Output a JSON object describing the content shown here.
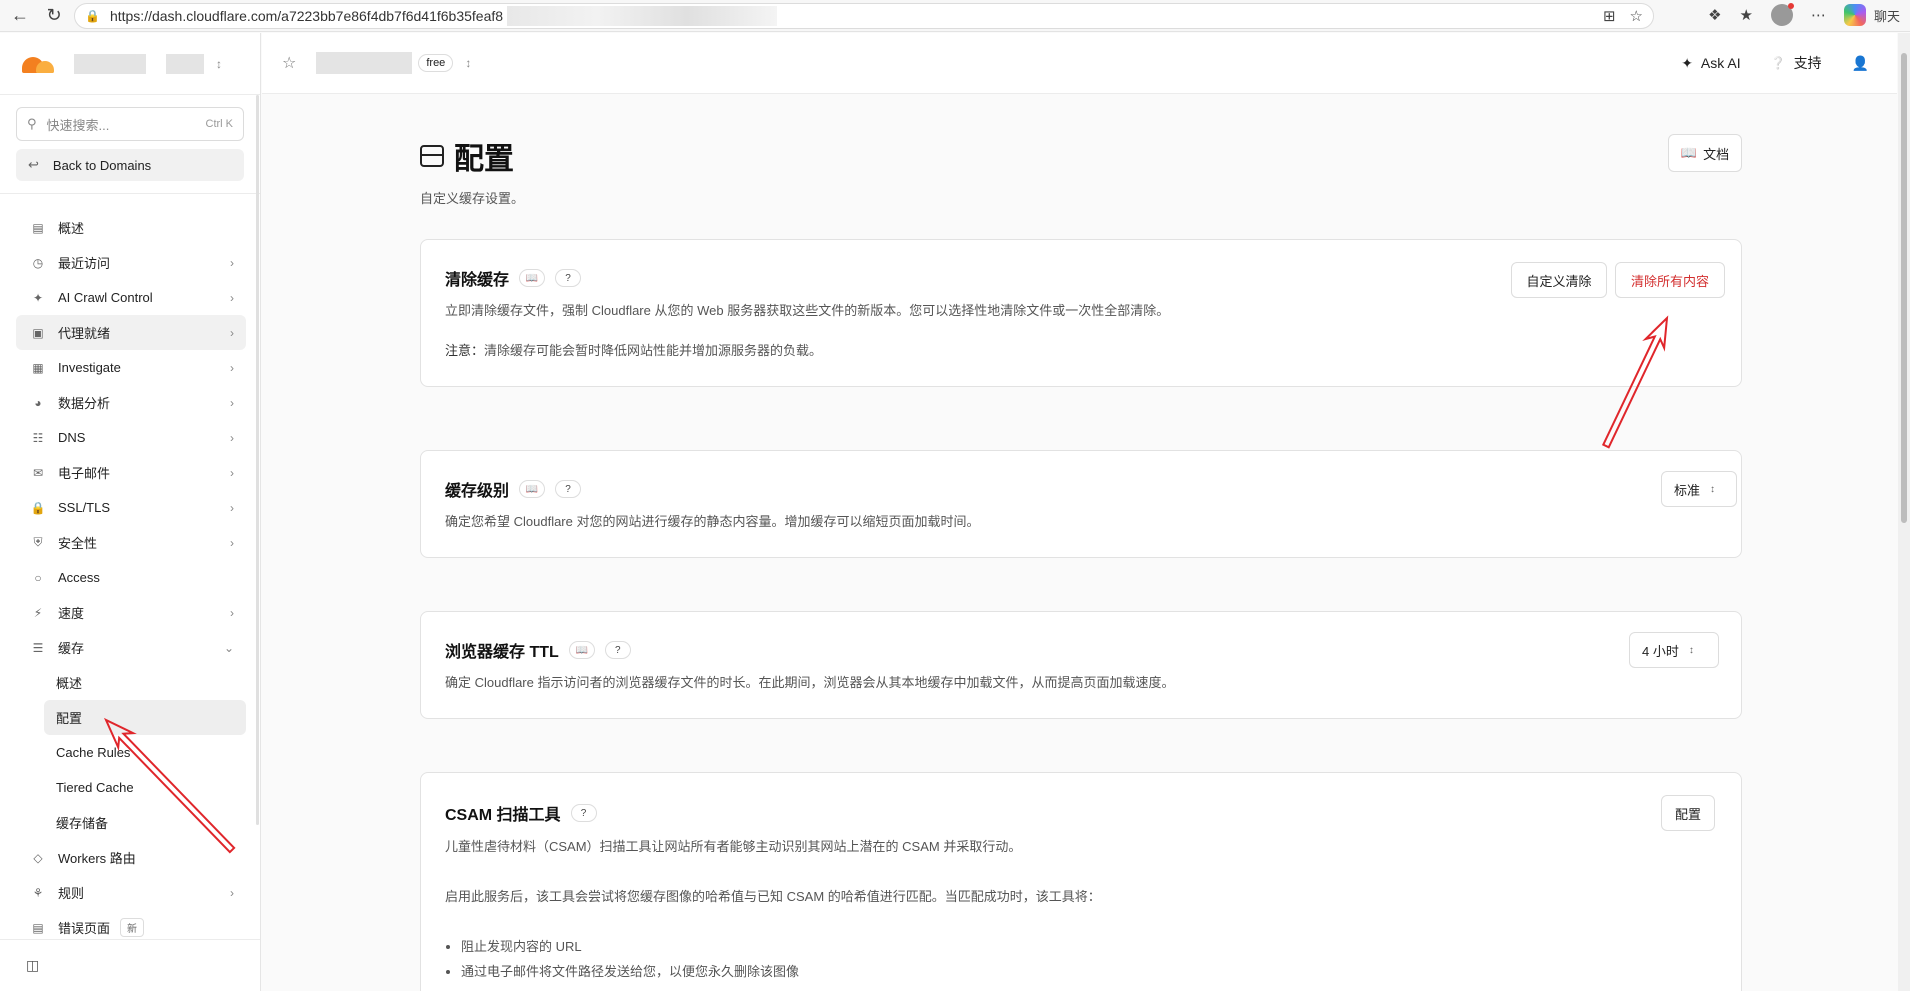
{
  "browser": {
    "url": "https://dash.cloudflare.com/a7223bb7e86f4db7f6d41f6b35feaf8",
    "copilot_label": "聊天"
  },
  "sidebar": {
    "search_placeholder": "快速搜索...",
    "search_shortcut": "Ctrl K",
    "back_label": "Back to Domains",
    "items": [
      {
        "label": "概述",
        "icon": "document-icon",
        "chevron": false
      },
      {
        "label": "最近访问",
        "icon": "clock-icon",
        "chevron": true
      },
      {
        "label": "AI Crawl Control",
        "icon": "ai-icon",
        "chevron": true
      },
      {
        "label": "代理就绪",
        "icon": "agent-icon",
        "chevron": true
      },
      {
        "label": "Investigate",
        "icon": "investigate-icon",
        "chevron": true
      },
      {
        "label": "数据分析",
        "icon": "analytics-icon",
        "chevron": true
      },
      {
        "label": "DNS",
        "icon": "dns-icon",
        "chevron": true
      },
      {
        "label": "电子邮件",
        "icon": "email-icon",
        "chevron": true
      },
      {
        "label": "SSL/TLS",
        "icon": "lock-icon",
        "chevron": true
      },
      {
        "label": "安全性",
        "icon": "shield-icon",
        "chevron": true
      },
      {
        "label": "Access",
        "icon": "access-icon",
        "chevron": false
      },
      {
        "label": "速度",
        "icon": "bolt-icon",
        "chevron": true
      },
      {
        "label": "缓存",
        "icon": "cache-icon",
        "chevron": true
      }
    ],
    "cache_sub": [
      "概述",
      "配置",
      "Cache Rules",
      "Tiered Cache",
      "缓存储备"
    ],
    "items_after": [
      {
        "label": "Workers 路由",
        "icon": "workers-icon",
        "chevron": false
      },
      {
        "label": "规则",
        "icon": "rules-icon",
        "chevron": true
      },
      {
        "label": "错误页面",
        "icon": "error-page-icon",
        "chevron": false,
        "badge": "新"
      }
    ]
  },
  "header": {
    "plan": "free",
    "ask_ai": "Ask AI",
    "support": "支持"
  },
  "page": {
    "title": "配置",
    "subtitle": "自定义缓存设置。",
    "docs_label": "文档"
  },
  "cards": {
    "purge": {
      "title": "清除缓存",
      "desc": "立即清除缓存文件，强制 Cloudflare 从您的 Web 服务器获取这些文件的新版本。您可以选择性地清除文件或一次性全部清除。",
      "note_label": "注意：",
      "note": "清除缓存可能会暂时降低网站性能并增加源服务器的负载。",
      "custom_btn": "自定义清除",
      "all_btn": "清除所有内容"
    },
    "level": {
      "title": "缓存级别",
      "desc": "确定您希望 Cloudflare 对您的网站进行缓存的静态内容量。增加缓存可以缩短页面加载时间。",
      "value": "标准"
    },
    "ttl": {
      "title": "浏览器缓存 TTL",
      "desc": "确定 Cloudflare 指示访问者的浏览器缓存文件的时长。在此期间，浏览器会从其本地缓存中加载文件，从而提高页面加载速度。",
      "value": "4 小时"
    },
    "csam": {
      "title": "CSAM 扫描工具",
      "desc": "儿童性虐待材料（CSAM）扫描工具让网站所有者能够主动识别其网站上潜在的 CSAM 并采取行动。",
      "desc2": "启用此服务后，该工具会尝试将您缓存图像的哈希值与已知 CSAM 的哈希值进行匹配。当匹配成功时，该工具将：",
      "bullets": [
        "阻止发现内容的 URL",
        "通过电子邮件将文件路径发送给您，以便您永久删除该图像"
      ],
      "config_btn": "配置"
    }
  },
  "annotations": {
    "arrow_color": "#e0262b"
  }
}
